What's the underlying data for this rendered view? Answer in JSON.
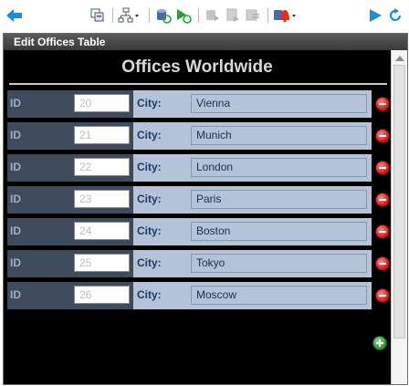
{
  "window": {
    "title": "Edit Offices Table"
  },
  "form": {
    "title": "Offices Worldwide",
    "id_label": "ID",
    "city_label": "City:",
    "rows": [
      {
        "id": "20",
        "city": "Vienna"
      },
      {
        "id": "21",
        "city": "Munich"
      },
      {
        "id": "22",
        "city": "London"
      },
      {
        "id": "23",
        "city": "Paris"
      },
      {
        "id": "24",
        "city": "Boston"
      },
      {
        "id": "25",
        "city": "Tokyo"
      },
      {
        "id": "26",
        "city": "Moscow"
      }
    ]
  },
  "toolbar": {
    "icons": [
      "back-arrow-icon",
      "copy-records-icon",
      "tree-view-icon",
      "database-refresh-icon",
      "execute-icon",
      "disabled-icon-1",
      "disabled-icon-2",
      "disabled-icon-3",
      "alert-icon",
      "run-icon",
      "refresh-icon"
    ]
  },
  "colors": {
    "id_background": "#3d4b5c",
    "city_background": "#b4c3d8",
    "remove": "#c41414",
    "add": "#2f8f2f",
    "accent": "#1e8cd0"
  }
}
